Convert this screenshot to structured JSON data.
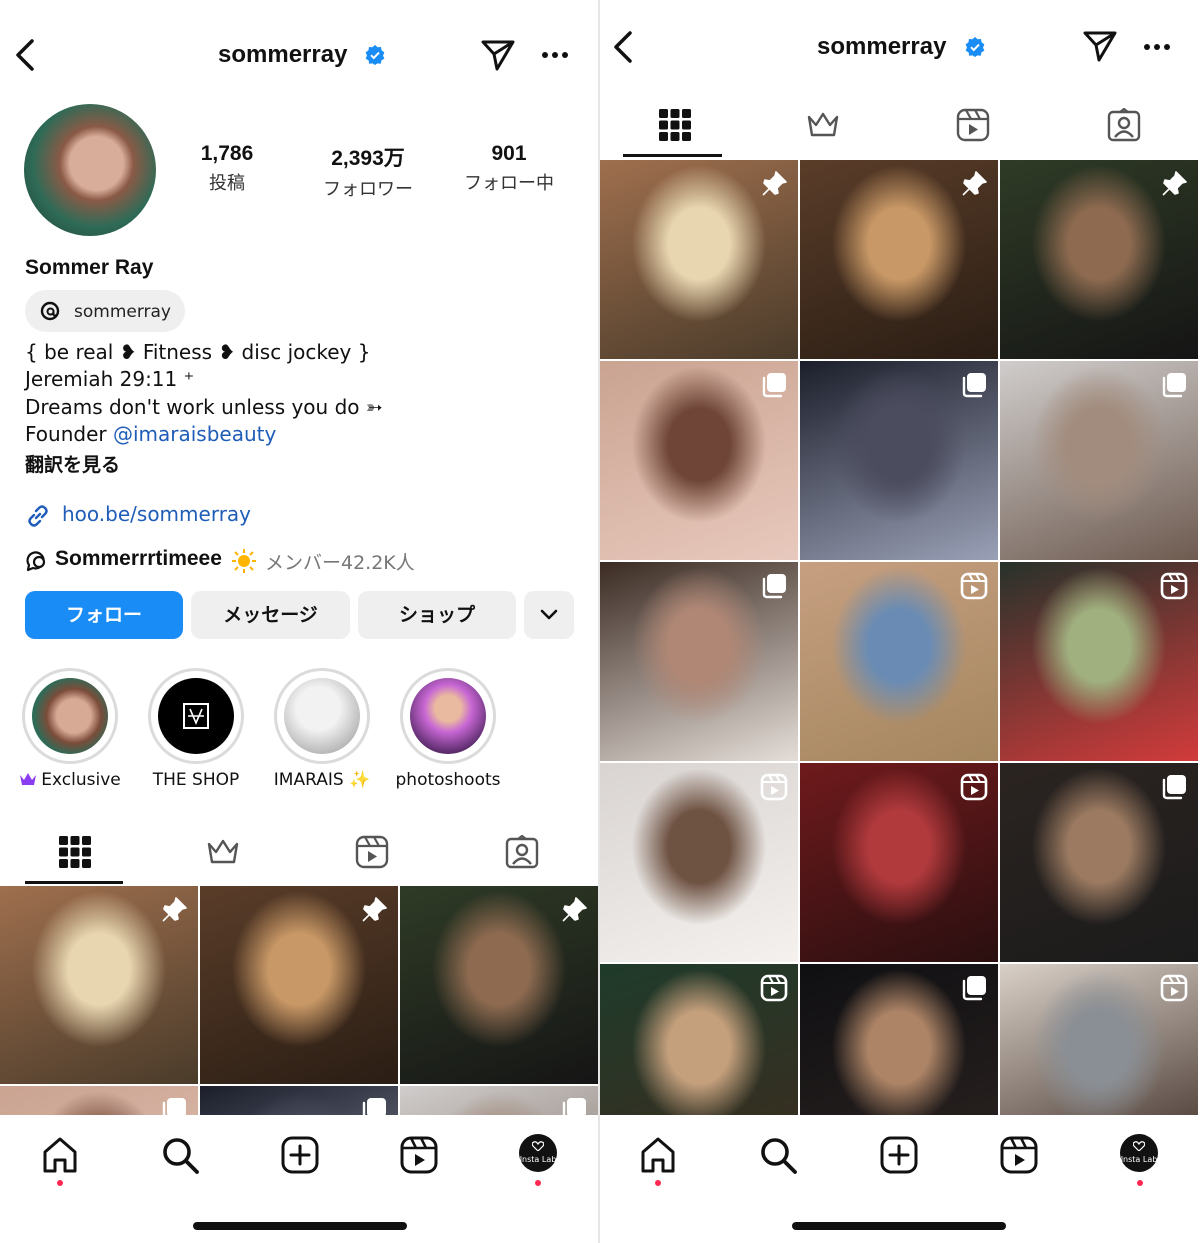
{
  "profile": {
    "username": "sommerray",
    "full_name": "Sommer Ray",
    "threads_handle": "sommerray",
    "stats": [
      {
        "value": "1,786",
        "label": "投稿"
      },
      {
        "value": "2,393万",
        "label": "フォロワー"
      },
      {
        "value": "901",
        "label": "フォロー中"
      }
    ],
    "bio": {
      "line1": "{ be real ❥ Fitness ❥ disc jockey }",
      "line2": " Jeremiah 29:11 ⁺",
      "line3": "Dreams don't work unless you do ➳",
      "line4_prefix": "Founder ",
      "line4_mention": "@imaraisbeauty",
      "translate": "翻訳を見る"
    },
    "link": "hoo.be/sommerray",
    "channel": {
      "name": "Sommerrrtimeee",
      "members": "メンバー42.2K人"
    }
  },
  "buttons": {
    "follow": "フォロー",
    "message": "メッセージ",
    "shop": "ショップ"
  },
  "highlights": [
    {
      "label": "Exclusive",
      "color": "#b98a7a"
    },
    {
      "label": "THE SHOP",
      "color": "#000000"
    },
    {
      "label": "IMARAIS ✨",
      "color": "#cfcfcf"
    },
    {
      "label": "photoshoots",
      "color": "#c76ad6"
    }
  ],
  "tabs": [
    "posts-grid",
    "subscriber-crown",
    "reels",
    "tagged"
  ],
  "nav": {
    "avatar_label": "Insta Lab"
  },
  "colors": {
    "accent": "#1a8cf5",
    "link": "#1f5db8",
    "verified": "#1a8cf5",
    "notification": "#ff2850"
  },
  "grid_posts": [
    {
      "badge": "pin",
      "colors": [
        "#9f6f4e",
        "#e8d6b0",
        "#4a3b2a"
      ]
    },
    {
      "badge": "pin",
      "colors": [
        "#5a3d29",
        "#c89866",
        "#2a1d14"
      ]
    },
    {
      "badge": "pin",
      "colors": [
        "#2f3b26",
        "#8d6a50",
        "#151515"
      ]
    },
    {
      "badge": "carousel",
      "colors": [
        "#caa391",
        "#6e4536",
        "#e8c9bd"
      ]
    },
    {
      "badge": "carousel",
      "colors": [
        "#1b1e2a",
        "#4b4c5e",
        "#9aa0b6"
      ]
    },
    {
      "badge": "carousel",
      "colors": [
        "#d0cdcc",
        "#a28c7d",
        "#6e5b50"
      ]
    },
    {
      "badge": "carousel",
      "colors": [
        "#3a2a22",
        "#b08775",
        "#e5ded8"
      ]
    },
    {
      "badge": "reel",
      "colors": [
        "#c69f80",
        "#6a8cb4",
        "#a4865f"
      ]
    },
    {
      "badge": "reel",
      "colors": [
        "#27322b",
        "#a0b07f",
        "#d23b3b"
      ]
    },
    {
      "badge": "reel",
      "colors": [
        "#d9d4d2",
        "#6e5242",
        "#f4f1ee"
      ]
    },
    {
      "badge": "reel",
      "colors": [
        "#6f1a1c",
        "#b13a3d",
        "#2a0f10"
      ]
    },
    {
      "badge": "carousel",
      "colors": [
        "#2b2421",
        "#9b7a61",
        "#1b1b1b"
      ]
    },
    {
      "badge": "reel",
      "colors": [
        "#1f3b2b",
        "#c5a07d",
        "#3a2c1f"
      ]
    },
    {
      "badge": "carousel",
      "colors": [
        "#0f0f12",
        "#ad8466",
        "#2a2220"
      ]
    },
    {
      "badge": "reel",
      "colors": [
        "#d9d0c8",
        "#8a8f95",
        "#3f2f27"
      ]
    }
  ]
}
